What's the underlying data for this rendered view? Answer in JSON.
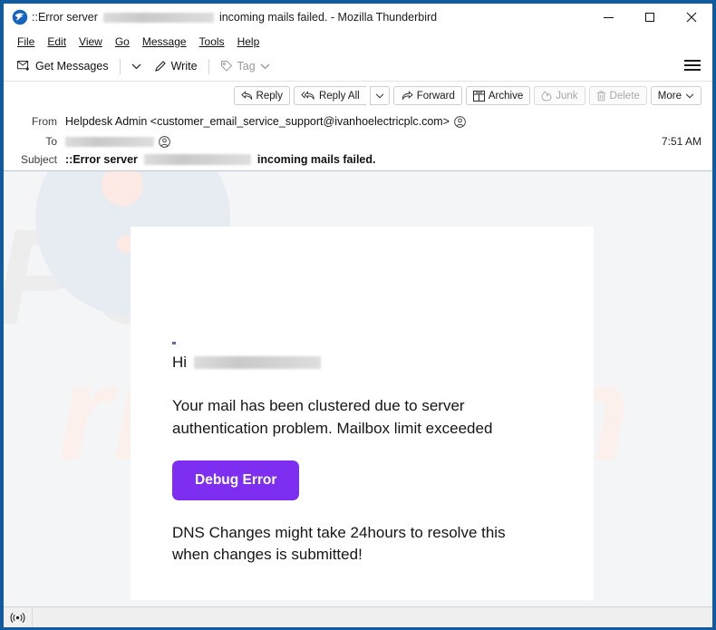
{
  "window": {
    "title_prefix": "::Error server",
    "title_suffix": "incoming mails failed. - Mozilla Thunderbird",
    "app_icon": "thunderbird-icon",
    "minimize_label": "Minimize",
    "maximize_label": "Maximize",
    "close_label": "Close"
  },
  "menubar": {
    "items": [
      {
        "label": "File",
        "accel": "F"
      },
      {
        "label": "Edit",
        "accel": "E"
      },
      {
        "label": "View",
        "accel": "V"
      },
      {
        "label": "Go",
        "accel": "G"
      },
      {
        "label": "Message",
        "accel": "M"
      },
      {
        "label": "Tools",
        "accel": "T"
      },
      {
        "label": "Help",
        "accel": "H"
      }
    ]
  },
  "toolbar": {
    "get_messages_label": "Get Messages",
    "get_messages_caret": "⌄",
    "write_label": "Write",
    "tag_label": "Tag",
    "tag_caret": "⌄",
    "menu_label": "Application Menu"
  },
  "message_actions": [
    {
      "label": "Reply",
      "icon": "reply-icon",
      "enabled": true
    },
    {
      "label": "Reply All",
      "icon": "reply-all-icon",
      "enabled": true
    },
    {
      "label": "Forward",
      "icon": "forward-icon",
      "enabled": true
    },
    {
      "label": "Archive",
      "icon": "archive-icon",
      "enabled": true
    },
    {
      "label": "Junk",
      "icon": "junk-icon",
      "enabled": false
    },
    {
      "label": "Delete",
      "icon": "trash-icon",
      "enabled": false
    },
    {
      "label": "More",
      "icon": "chevron-down-icon",
      "enabled": true
    }
  ],
  "headers": {
    "from_label": "From",
    "from_value": "Helpdesk Admin <customer_email_service_support@ivanhoelectricplc.com>",
    "to_label": "To",
    "to_value_redacted": true,
    "time": "7:51 AM",
    "subject_label": "Subject",
    "subject_prefix": "::Error server",
    "subject_suffix": "incoming mails failed."
  },
  "body": {
    "greeting": "Hi",
    "greeting_redacted": true,
    "paragraph_1": "Your mail has been clustered due to server authentication problem. Mailbox limit exceeded",
    "cta_label": "Debug Error",
    "cta_color": "#7d2ef0",
    "paragraph_2": "DNS Changes might take 24hours to resolve this when changes is submitted!",
    "watermark_text": "PC",
    "watermark_text_2": "risk.com"
  },
  "statusbar": {
    "connection_icon": "connection-online-icon",
    "text": ""
  },
  "colors": {
    "window_frame": "#125A9E",
    "accent_purple": "#7d2ef0",
    "body_bg": "#f4f5f6"
  }
}
